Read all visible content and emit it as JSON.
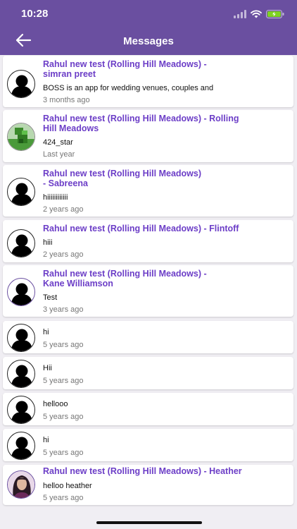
{
  "status_bar": {
    "time": "10:28"
  },
  "header": {
    "title": "Messages"
  },
  "messages": [
    {
      "title_line1": "Rahul new test (Rolling Hill Meadows) -",
      "title_line2": "simran preet",
      "text": "BOSS is an app for wedding venues, couples and",
      "time": "3 months ago",
      "avatar": "silhouette-icon"
    },
    {
      "title_line1": "Rahul new test (Rolling Hill Meadows) - Rolling",
      "title_line2": "Hill Meadows",
      "text": "424_star",
      "time": "Last year",
      "avatar": "photo-avatar"
    },
    {
      "title_line1": "Rahul new test (Rolling Hill Meadows)",
      "title_line2": "- Sabreena",
      "text": "hiiiiiiiiiiii",
      "time": "2 years ago",
      "avatar": "silhouette-icon"
    },
    {
      "title_line1": "Rahul new test (Rolling Hill Meadows) - Flintoff",
      "title_line2": "",
      "text": "hiii",
      "time": "2 years ago",
      "avatar": "silhouette-icon"
    },
    {
      "title_line1": "Rahul new test (Rolling Hill Meadows) -",
      "title_line2": "Kane Williamson",
      "text": "Test",
      "time": "3 years ago",
      "avatar": "silhouette-icon"
    },
    {
      "title_line1": "",
      "title_line2": "",
      "text": "hi",
      "time": "5 years ago",
      "avatar": "silhouette-icon"
    },
    {
      "title_line1": "",
      "title_line2": "",
      "text": "Hii",
      "time": "5 years ago",
      "avatar": "silhouette-icon"
    },
    {
      "title_line1": "",
      "title_line2": "",
      "text": "hellooo",
      "time": "5 years ago",
      "avatar": "silhouette-icon"
    },
    {
      "title_line1": "",
      "title_line2": "",
      "text": "hi",
      "time": "5 years ago",
      "avatar": "silhouette-icon"
    },
    {
      "title_line1": "Rahul new test (Rolling Hill Meadows) - Heather",
      "title_line2": "",
      "text": "helloo heather",
      "time": "5 years ago",
      "avatar": "photo-avatar"
    }
  ],
  "colors": {
    "header": "#6a4fa0",
    "title": "#6c3ec7",
    "time": "#777777",
    "battery": "#7ed321"
  }
}
